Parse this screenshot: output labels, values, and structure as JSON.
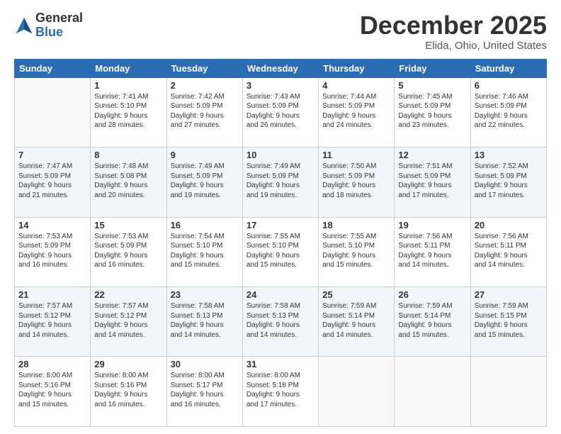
{
  "header": {
    "logo_general": "General",
    "logo_blue": "Blue",
    "month_title": "December 2025",
    "location": "Elida, Ohio, United States"
  },
  "days_of_week": [
    "Sunday",
    "Monday",
    "Tuesday",
    "Wednesday",
    "Thursday",
    "Friday",
    "Saturday"
  ],
  "weeks": [
    [
      {
        "day": "",
        "info": ""
      },
      {
        "day": "1",
        "info": "Sunrise: 7:41 AM\nSunset: 5:10 PM\nDaylight: 9 hours\nand 28 minutes."
      },
      {
        "day": "2",
        "info": "Sunrise: 7:42 AM\nSunset: 5:09 PM\nDaylight: 9 hours\nand 27 minutes."
      },
      {
        "day": "3",
        "info": "Sunrise: 7:43 AM\nSunset: 5:09 PM\nDaylight: 9 hours\nand 26 minutes."
      },
      {
        "day": "4",
        "info": "Sunrise: 7:44 AM\nSunset: 5:09 PM\nDaylight: 9 hours\nand 24 minutes."
      },
      {
        "day": "5",
        "info": "Sunrise: 7:45 AM\nSunset: 5:09 PM\nDaylight: 9 hours\nand 23 minutes."
      },
      {
        "day": "6",
        "info": "Sunrise: 7:46 AM\nSunset: 5:09 PM\nDaylight: 9 hours\nand 22 minutes."
      }
    ],
    [
      {
        "day": "7",
        "info": "Sunrise: 7:47 AM\nSunset: 5:09 PM\nDaylight: 9 hours\nand 21 minutes."
      },
      {
        "day": "8",
        "info": "Sunrise: 7:48 AM\nSunset: 5:08 PM\nDaylight: 9 hours\nand 20 minutes."
      },
      {
        "day": "9",
        "info": "Sunrise: 7:49 AM\nSunset: 5:09 PM\nDaylight: 9 hours\nand 19 minutes."
      },
      {
        "day": "10",
        "info": "Sunrise: 7:49 AM\nSunset: 5:09 PM\nDaylight: 9 hours\nand 19 minutes."
      },
      {
        "day": "11",
        "info": "Sunrise: 7:50 AM\nSunset: 5:09 PM\nDaylight: 9 hours\nand 18 minutes."
      },
      {
        "day": "12",
        "info": "Sunrise: 7:51 AM\nSunset: 5:09 PM\nDaylight: 9 hours\nand 17 minutes."
      },
      {
        "day": "13",
        "info": "Sunrise: 7:52 AM\nSunset: 5:09 PM\nDaylight: 9 hours\nand 17 minutes."
      }
    ],
    [
      {
        "day": "14",
        "info": "Sunrise: 7:53 AM\nSunset: 5:09 PM\nDaylight: 9 hours\nand 16 minutes."
      },
      {
        "day": "15",
        "info": "Sunrise: 7:53 AM\nSunset: 5:09 PM\nDaylight: 9 hours\nand 16 minutes."
      },
      {
        "day": "16",
        "info": "Sunrise: 7:54 AM\nSunset: 5:10 PM\nDaylight: 9 hours\nand 15 minutes."
      },
      {
        "day": "17",
        "info": "Sunrise: 7:55 AM\nSunset: 5:10 PM\nDaylight: 9 hours\nand 15 minutes."
      },
      {
        "day": "18",
        "info": "Sunrise: 7:55 AM\nSunset: 5:10 PM\nDaylight: 9 hours\nand 15 minutes."
      },
      {
        "day": "19",
        "info": "Sunrise: 7:56 AM\nSunset: 5:11 PM\nDaylight: 9 hours\nand 14 minutes."
      },
      {
        "day": "20",
        "info": "Sunrise: 7:56 AM\nSunset: 5:11 PM\nDaylight: 9 hours\nand 14 minutes."
      }
    ],
    [
      {
        "day": "21",
        "info": "Sunrise: 7:57 AM\nSunset: 5:12 PM\nDaylight: 9 hours\nand 14 minutes."
      },
      {
        "day": "22",
        "info": "Sunrise: 7:57 AM\nSunset: 5:12 PM\nDaylight: 9 hours\nand 14 minutes."
      },
      {
        "day": "23",
        "info": "Sunrise: 7:58 AM\nSunset: 5:13 PM\nDaylight: 9 hours\nand 14 minutes."
      },
      {
        "day": "24",
        "info": "Sunrise: 7:58 AM\nSunset: 5:13 PM\nDaylight: 9 hours\nand 14 minutes."
      },
      {
        "day": "25",
        "info": "Sunrise: 7:59 AM\nSunset: 5:14 PM\nDaylight: 9 hours\nand 14 minutes."
      },
      {
        "day": "26",
        "info": "Sunrise: 7:59 AM\nSunset: 5:14 PM\nDaylight: 9 hours\nand 15 minutes."
      },
      {
        "day": "27",
        "info": "Sunrise: 7:59 AM\nSunset: 5:15 PM\nDaylight: 9 hours\nand 15 minutes."
      }
    ],
    [
      {
        "day": "28",
        "info": "Sunrise: 8:00 AM\nSunset: 5:16 PM\nDaylight: 9 hours\nand 15 minutes."
      },
      {
        "day": "29",
        "info": "Sunrise: 8:00 AM\nSunset: 5:16 PM\nDaylight: 9 hours\nand 16 minutes."
      },
      {
        "day": "30",
        "info": "Sunrise: 8:00 AM\nSunset: 5:17 PM\nDaylight: 9 hours\nand 16 minutes."
      },
      {
        "day": "31",
        "info": "Sunrise: 8:00 AM\nSunset: 5:18 PM\nDaylight: 9 hours\nand 17 minutes."
      },
      {
        "day": "",
        "info": ""
      },
      {
        "day": "",
        "info": ""
      },
      {
        "day": "",
        "info": ""
      }
    ]
  ]
}
